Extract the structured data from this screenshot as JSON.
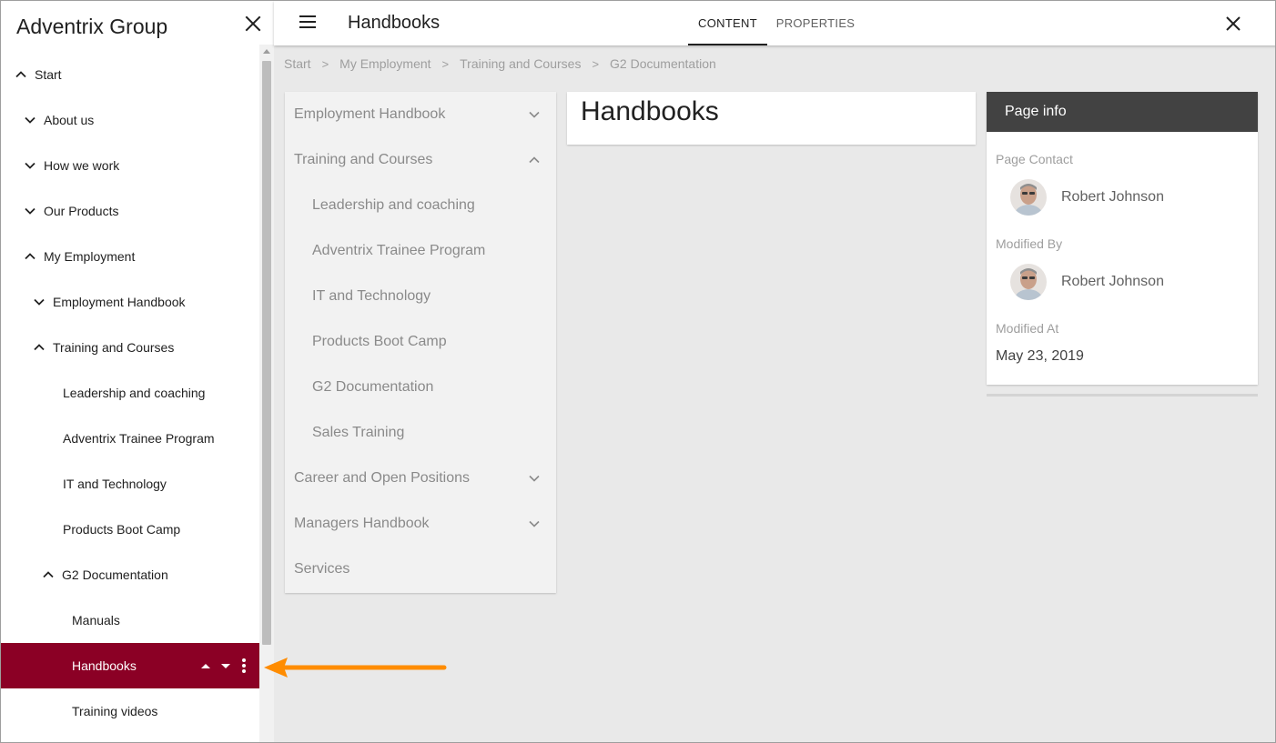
{
  "drawer": {
    "title": "Adventrix Group",
    "items": [
      {
        "label": "Start",
        "expanded": true
      },
      {
        "label": "About us",
        "expanded": false
      },
      {
        "label": "How we work",
        "expanded": false
      },
      {
        "label": "Our Products",
        "expanded": false
      },
      {
        "label": "My Employment",
        "expanded": true
      },
      {
        "label": "Employment Handbook",
        "expanded": false
      },
      {
        "label": "Training and Courses",
        "expanded": true
      },
      {
        "label": "Leadership and coaching"
      },
      {
        "label": "Adventrix Trainee Program"
      },
      {
        "label": "IT and Technology"
      },
      {
        "label": "Products Boot Camp"
      },
      {
        "label": "G2 Documentation",
        "expanded": true
      },
      {
        "label": "Manuals"
      },
      {
        "label": "Handbooks",
        "selected": true
      },
      {
        "label": "Training videos"
      }
    ]
  },
  "header": {
    "title": "Handbooks",
    "tabs": {
      "content": "CONTENT",
      "properties": "PROPERTIES"
    }
  },
  "breadcrumb": [
    "Start",
    "My Employment",
    "Training and Courses",
    "G2 Documentation"
  ],
  "breadcrumb_separator": ">",
  "subnav": {
    "items": [
      {
        "label": "Employment Handbook",
        "expanded": false
      },
      {
        "label": "Training and Courses",
        "expanded": true
      },
      {
        "label": "Leadership and coaching"
      },
      {
        "label": "Adventrix Trainee Program"
      },
      {
        "label": "IT and Technology"
      },
      {
        "label": "Products Boot Camp"
      },
      {
        "label": "G2 Documentation"
      },
      {
        "label": "Sales Training"
      },
      {
        "label": "Career and Open Positions",
        "expanded": false
      },
      {
        "label": "Managers Handbook",
        "expanded": false
      },
      {
        "label": "Services"
      }
    ]
  },
  "content": {
    "heading": "Handbooks"
  },
  "page_info": {
    "title": "Page info",
    "contact_label": "Page Contact",
    "contact_name": "Robert Johnson",
    "modified_by_label": "Modified By",
    "modified_by_name": "Robert Johnson",
    "modified_at_label": "Modified At",
    "modified_at": "May 23, 2019"
  },
  "colors": {
    "selected_bg": "#8b0025",
    "info_header": "#424242",
    "annotation_arrow": "#ff8c00",
    "main_bg": "#e9e9e9"
  }
}
